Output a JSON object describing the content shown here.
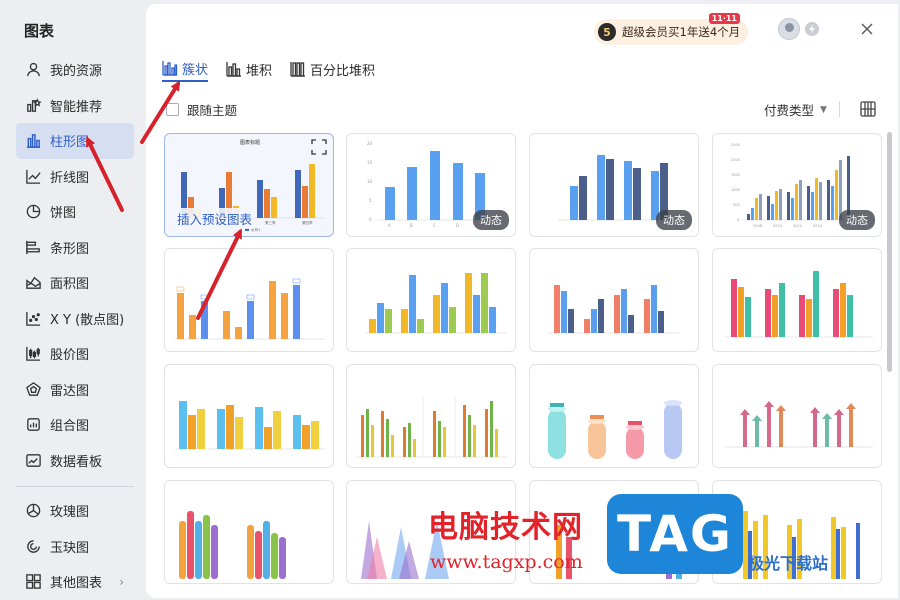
{
  "sidebar": {
    "title": "图表",
    "items": [
      {
        "label": "我的资源",
        "icon": "user-icon"
      },
      {
        "label": "智能推荐",
        "icon": "recommend-icon"
      },
      {
        "label": "柱形图",
        "icon": "bar-chart-icon",
        "active": true
      },
      {
        "label": "折线图",
        "icon": "line-chart-icon"
      },
      {
        "label": "饼图",
        "icon": "pie-chart-icon"
      },
      {
        "label": "条形图",
        "icon": "horizontal-bar-icon"
      },
      {
        "label": "面积图",
        "icon": "area-chart-icon"
      },
      {
        "label": "X Y (散点图)",
        "icon": "scatter-icon"
      },
      {
        "label": "股价图",
        "icon": "stock-chart-icon"
      },
      {
        "label": "雷达图",
        "icon": "radar-chart-icon"
      },
      {
        "label": "组合图",
        "icon": "combo-chart-icon"
      },
      {
        "label": "数据看板",
        "icon": "dashboard-icon"
      }
    ],
    "items2": [
      {
        "label": "玫瑰图",
        "icon": "rose-chart-icon"
      },
      {
        "label": "玉玦图",
        "icon": "jade-ring-icon"
      },
      {
        "label": "其他图表",
        "icon": "other-charts-icon"
      }
    ]
  },
  "header": {
    "promo_text": "超级会员买1年送4个月",
    "promo_badge": "5",
    "promo_tag": "11·11"
  },
  "tabs": [
    {
      "label": "簇状",
      "active": true
    },
    {
      "label": "堆积"
    },
    {
      "label": "百分比堆积"
    }
  ],
  "filters": {
    "follow_theme": "跟随主题",
    "pay_type": "付费类型"
  },
  "cards": {
    "insert_label": "插入预设图表",
    "dynamic_label": "动态",
    "first_card_title": "图表标题",
    "first_card_legend": "系列1",
    "first_card_xlabels": [
      "第一季",
      "第二季",
      "第三季",
      "第四季"
    ],
    "card3_xlabels": [
      "2008",
      "2010",
      "2012",
      "2014"
    ],
    "card1_xlabels": [
      "A",
      "B",
      "C",
      "D",
      "E"
    ],
    "card1_yticks": [
      "0",
      "5",
      "10",
      "15",
      "20"
    ],
    "card3_yticks": [
      "0",
      "500",
      "1000",
      "1500",
      "2000",
      "2500"
    ]
  },
  "watermark": {
    "text": "电脑技术网",
    "url": "www.tagxp.com",
    "tag": "TAG",
    "site": "极光下载站"
  },
  "colors": {
    "accent": "#2f5fc8",
    "arrow": "#d6222a"
  }
}
